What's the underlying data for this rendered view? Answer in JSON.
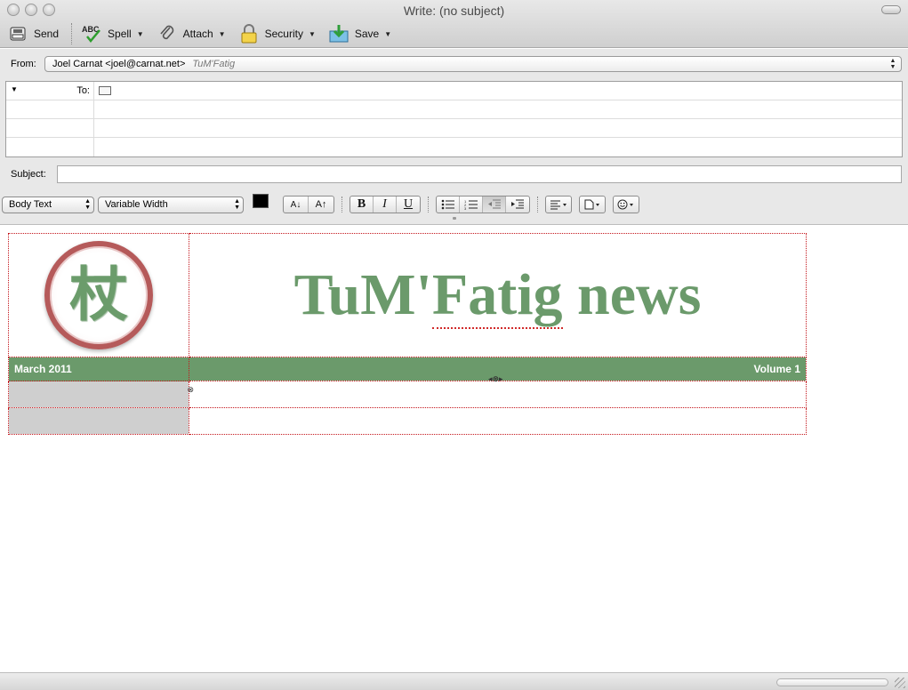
{
  "window": {
    "title": "Write: (no subject)"
  },
  "toolbar": {
    "send": "Send",
    "spell": "Spell",
    "attach": "Attach",
    "security": "Security",
    "save": "Save"
  },
  "header": {
    "from_label": "From:",
    "from_value": "Joel Carnat <joel@carnat.net>",
    "from_identity": "TuM'Fatig",
    "to_label": "To:",
    "to_value": "",
    "subject_label": "Subject:",
    "subject_value": ""
  },
  "format": {
    "paragraph_style": "Body Text",
    "font": "Variable Width",
    "text_color": "#000000",
    "background_color": "#ffffff",
    "bold": "B",
    "italic": "I",
    "underline": "U"
  },
  "newsletter": {
    "logo_glyph": "杖",
    "title_part1": "TuM'",
    "title_misspelled": "Fatig",
    "title_part2": " news",
    "date": "March 2011",
    "volume": "Volume 1",
    "accent_color": "#6b9a6b"
  },
  "icons": [
    "send-icon",
    "spell-check-icon",
    "paperclip-icon",
    "lock-icon",
    "save-icon",
    "address-card-icon",
    "bulleted-list-icon",
    "numbered-list-icon",
    "outdent-icon",
    "indent-icon",
    "align-left-icon",
    "insert-icon",
    "smiley-icon"
  ]
}
